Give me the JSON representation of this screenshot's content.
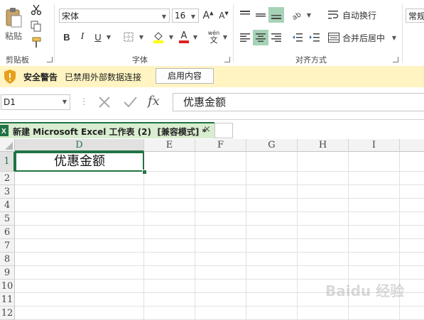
{
  "ribbon": {
    "clipboard": {
      "paste_label": "粘贴",
      "group_label": "剪贴板"
    },
    "font": {
      "font_name": "宋体",
      "font_size": "16",
      "bold": "B",
      "italic": "I",
      "underline": "U",
      "group_label": "字体",
      "wen_label": "wén",
      "wen_char": "文"
    },
    "alignment": {
      "wrap_text_label": "自动换行",
      "merge_center_label": "合并后居中",
      "group_label": "对齐方式"
    },
    "number": {
      "format_value": "常规"
    }
  },
  "security_bar": {
    "title": "安全警告",
    "message": "已禁用外部数据连接",
    "enable_button": "启用内容"
  },
  "formula_bar": {
    "name_box": "D1",
    "formula": "优惠金额",
    "fx": "fx"
  },
  "workbook_tab": {
    "title": "新建 Microsoft Excel 工作表 (2)  [兼容模式] *",
    "close": "×"
  },
  "grid": {
    "columns": [
      "D",
      "E",
      "F",
      "G",
      "H",
      "I"
    ],
    "rows": [
      "1",
      "2",
      "3",
      "4",
      "5",
      "6",
      "7",
      "8",
      "9",
      "10",
      "11",
      "12"
    ],
    "cells": {
      "D1": "优惠金额"
    }
  },
  "watermark": "Baidu 经验"
}
